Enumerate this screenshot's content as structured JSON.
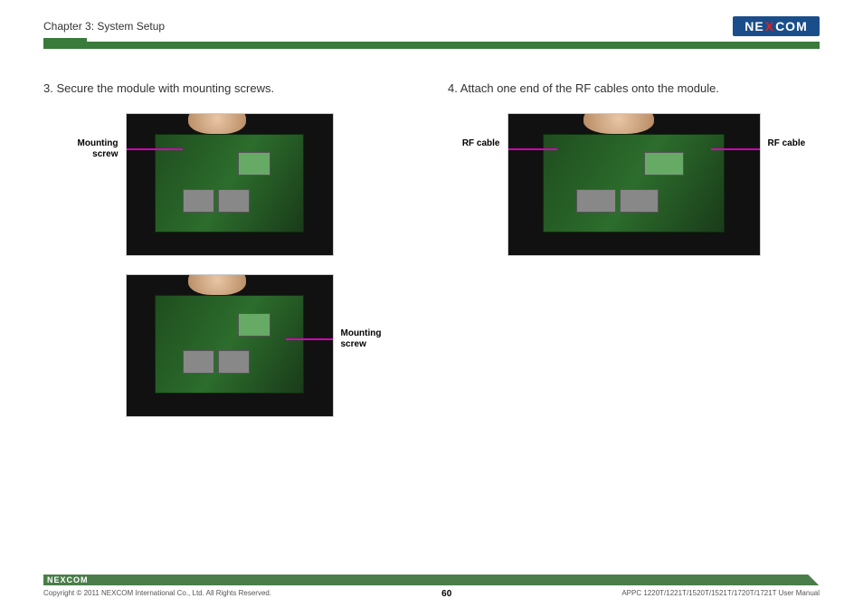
{
  "header": {
    "chapter": "Chapter 3: System Setup",
    "logo_pre": "NE",
    "logo_x": "X",
    "logo_post": "COM"
  },
  "steps": {
    "three": "3.  Secure the module with mounting screws.",
    "four": "4.  Attach one end of the RF cables onto the module."
  },
  "labels": {
    "mounting_screw": "Mounting screw",
    "rf_cable": "RF cable"
  },
  "footer": {
    "logo_text": "NEXCOM",
    "copyright": "Copyright © 2011 NEXCOM International Co., Ltd. All Rights Reserved.",
    "page_number": "60",
    "manual": "APPC 1220T/1221T/1520T/1521T/1720T/1721T User Manual"
  }
}
